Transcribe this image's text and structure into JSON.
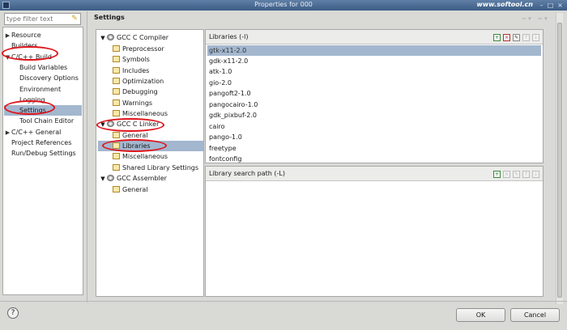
{
  "window": {
    "title": "Properties for 000",
    "watermark": "www.softool.cn"
  },
  "filter": {
    "placeholder": "type filter text"
  },
  "nav": {
    "items": [
      {
        "label": "Resource",
        "arrow": "▶"
      },
      {
        "label": "Builders",
        "arrow": ""
      },
      {
        "label": "C/C++ Build",
        "arrow": "▼"
      },
      {
        "label": "Build Variables",
        "arrow": ""
      },
      {
        "label": "Discovery Options",
        "arrow": ""
      },
      {
        "label": "Environment",
        "arrow": ""
      },
      {
        "label": "Logging",
        "arrow": ""
      },
      {
        "label": "Settings",
        "arrow": ""
      },
      {
        "label": "Tool Chain Editor",
        "arrow": ""
      },
      {
        "label": "C/C++ General",
        "arrow": "▶"
      },
      {
        "label": "Project References",
        "arrow": ""
      },
      {
        "label": "Run/Debug Settings",
        "arrow": ""
      }
    ],
    "selected": "Settings"
  },
  "settings": {
    "title": "Settings"
  },
  "tree": {
    "items": [
      {
        "label": "GCC C Compiler",
        "kind": "group"
      },
      {
        "label": "Preprocessor",
        "kind": "option"
      },
      {
        "label": "Symbols",
        "kind": "option"
      },
      {
        "label": "Includes",
        "kind": "option"
      },
      {
        "label": "Optimization",
        "kind": "option"
      },
      {
        "label": "Debugging",
        "kind": "option"
      },
      {
        "label": "Warnings",
        "kind": "option"
      },
      {
        "label": "Miscellaneous",
        "kind": "option"
      },
      {
        "label": "GCC C Linker",
        "kind": "group"
      },
      {
        "label": "General",
        "kind": "option"
      },
      {
        "label": "Libraries",
        "kind": "option"
      },
      {
        "label": "Miscellaneous",
        "kind": "option"
      },
      {
        "label": "Shared Library Settings",
        "kind": "option"
      },
      {
        "label": "GCC Assembler",
        "kind": "group"
      },
      {
        "label": "General",
        "kind": "option"
      }
    ],
    "selected": "Libraries"
  },
  "libraries": {
    "header": "Libraries (-l)",
    "items": [
      "gtk-x11-2.0",
      "gdk-x11-2.0",
      "atk-1.0",
      "gio-2.0",
      "pangoft2-1.0",
      "pangocairo-1.0",
      "gdk_pixbuf-2.0",
      "cairo",
      "pango-1.0",
      "freetype",
      "fontconfig"
    ],
    "selected": "gtk-x11-2.0"
  },
  "search_path": {
    "header": "Library search path (-L)"
  },
  "buttons": {
    "ok": "OK",
    "cancel": "Cancel",
    "help": "?"
  },
  "colors": {
    "selection": "#a3b7cf",
    "annotation": "#e0141b",
    "titlebar": "#3c5c85"
  },
  "icons": [
    "app-icon",
    "clear-filter-icon",
    "gear-icon",
    "option-icon",
    "add-icon",
    "delete-icon",
    "edit-icon",
    "move-up-icon",
    "move-down-icon",
    "back-icon",
    "forward-icon",
    "help-icon"
  ]
}
